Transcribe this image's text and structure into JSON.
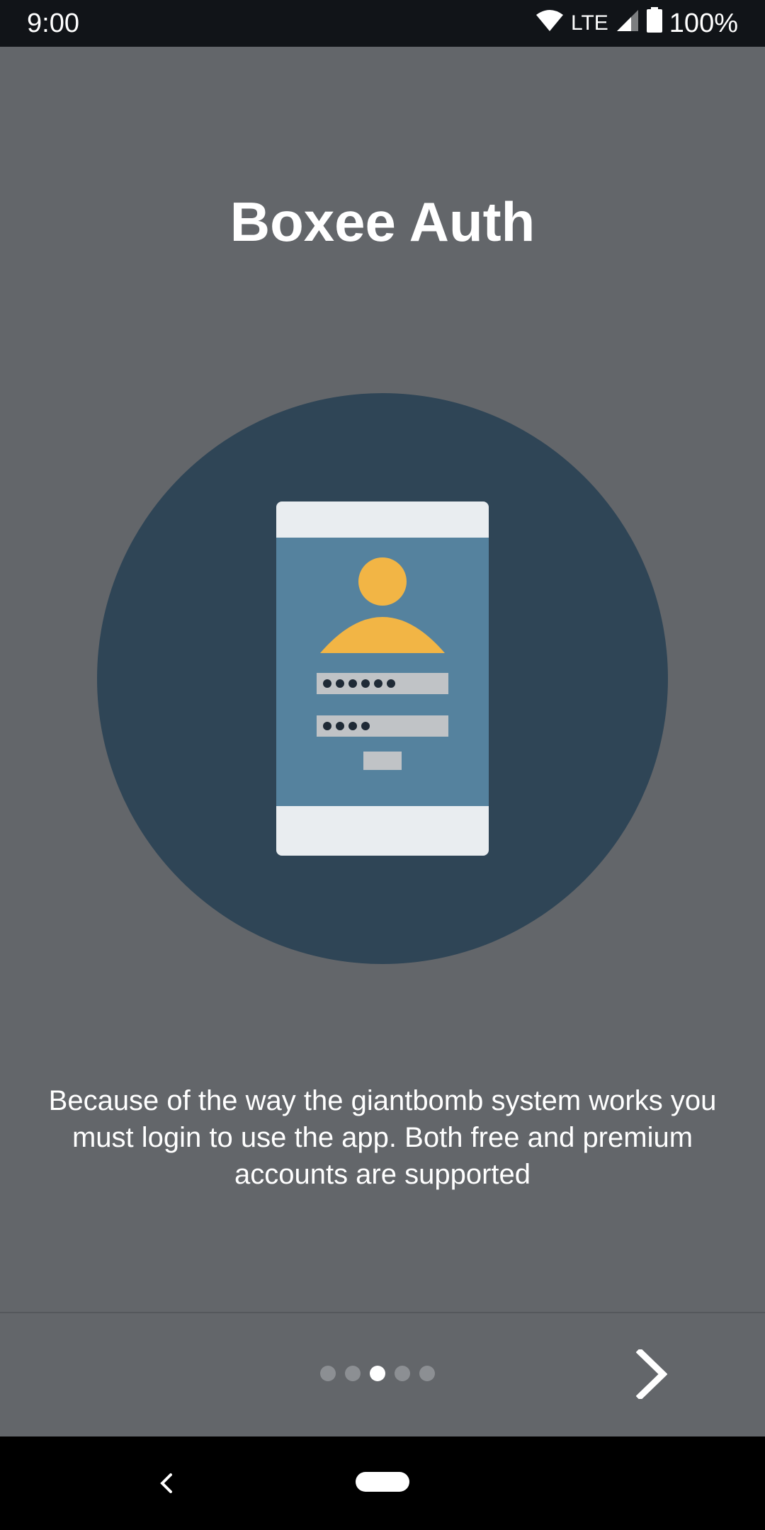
{
  "status_bar": {
    "time": "9:00",
    "network": "LTE",
    "battery": "100%",
    "icons": [
      "wifi-icon",
      "signal-icon",
      "battery-icon"
    ]
  },
  "onboarding": {
    "title": "Boxee Auth",
    "illustration": "phone-login-icon",
    "description": "Because of the way the giantbomb system works you must login to use the app. Both free and premium accounts are supported",
    "pager": {
      "total": 5,
      "current": 3
    },
    "next_icon": "chevron-right-icon"
  },
  "navigation_bar": {
    "back_icon": "back-icon",
    "home_icon": "home-pill-icon"
  },
  "colors": {
    "background": "#63666a",
    "status_bar": "#111418",
    "circle": "#2f4556",
    "phone_screen": "#55829e",
    "phone_frame": "#e9edf0",
    "avatar": "#f2b545",
    "field": "#c0c3c6",
    "password_dots": "#1f2a36"
  }
}
